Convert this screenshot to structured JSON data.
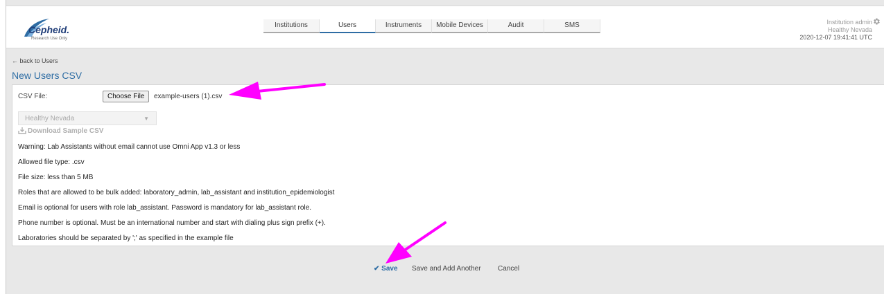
{
  "brand": {
    "name": "Cepheid.",
    "tagline": "Research Use Only"
  },
  "nav": {
    "tabs": [
      {
        "label": "Institutions"
      },
      {
        "label": "Users",
        "active": true
      },
      {
        "label": "Instruments"
      },
      {
        "label": "Mobile Devices"
      },
      {
        "label": "Audit"
      },
      {
        "label": "SMS"
      }
    ]
  },
  "user": {
    "role": "Institution admin",
    "institution": "Healthy Nevada",
    "timestamp": "2020-12-07 19:41:41 UTC"
  },
  "breadcrumb": {
    "back_label": "← back to Users"
  },
  "page": {
    "title": "New Users CSV"
  },
  "form": {
    "csv_label": "CSV File:",
    "choose_file_label": "Choose File",
    "file_name": "example-users (1).csv",
    "institution_select": {
      "value": "Healthy Nevada"
    },
    "download_label": "Download Sample CSV"
  },
  "info_lines": [
    "Warning: Lab Assistants without email cannot use Omni App v1.3 or less",
    "Allowed file type: .csv",
    "File size: less than 5 MB",
    "Roles that are allowed to be bulk added: laboratory_admin, lab_assistant and institution_epidemiologist",
    "Email is optional for users with role lab_assistant. Password is mandatory for lab_assistant role.",
    "Phone number is optional. Must be an international number and start with dialing plus sign prefix (+).",
    "Laboratories should be separated by ';' as specified in the example file"
  ],
  "actions": {
    "save_label": "✔ Save",
    "save_another_label": "Save and Add Another",
    "cancel_label": "Cancel"
  },
  "colors": {
    "accent": "#2e6da4",
    "annotation": "#ff00ff"
  },
  "icons": [
    "gear-icon",
    "download-icon",
    "chevron-down-icon",
    "checkmark-icon"
  ]
}
